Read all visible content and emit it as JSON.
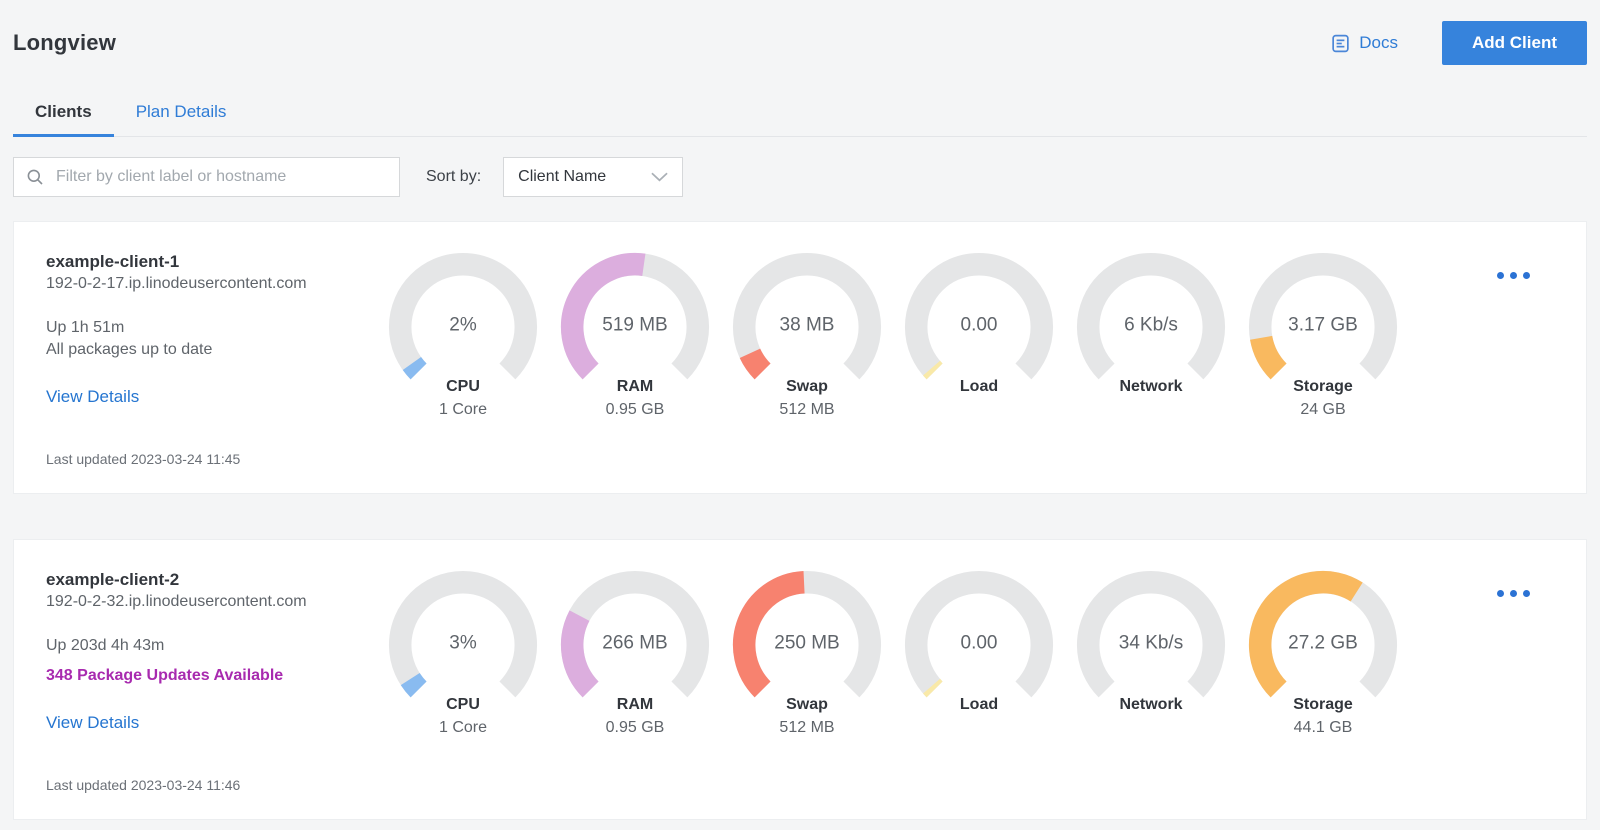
{
  "page": {
    "title": "Longview"
  },
  "header": {
    "docs_label": "Docs",
    "add_client_label": "Add Client"
  },
  "tabs": [
    {
      "label": "Clients",
      "active": true
    },
    {
      "label": "Plan Details",
      "active": false
    }
  ],
  "filter": {
    "placeholder": "Filter by client label or hostname",
    "sort_by_label": "Sort by:",
    "sort_value": "Client Name"
  },
  "colors": {
    "accent_blue": "#3683dc",
    "link_blue": "#2575d0",
    "package_alert_purple": "#a82aaf",
    "gauge_track": "#e5e6e7"
  },
  "clients": [
    {
      "name": "example-client-1",
      "hostname": "192-0-2-17.ip.linodeusercontent.com",
      "uptime": "Up 1h 51m",
      "packages": "All packages up to date",
      "packages_highlight": false,
      "view_details_label": "View Details",
      "last_updated": "Last updated 2023-03-24 11:45",
      "gauges": [
        {
          "metric": "CPU",
          "value": "2%",
          "subtitle": "1 Core",
          "fraction": 0.035,
          "color": "#89bbf0"
        },
        {
          "metric": "RAM",
          "value": "519 MB",
          "subtitle": "0.95 GB",
          "fraction": 0.53,
          "color": "#dcaede"
        },
        {
          "metric": "Swap",
          "value": "38 MB",
          "subtitle": "512 MB",
          "fraction": 0.075,
          "color": "#f7826f"
        },
        {
          "metric": "Load",
          "value": "0.00",
          "subtitle": "",
          "fraction": 0.015,
          "color": "#f9e9a8"
        },
        {
          "metric": "Network",
          "value": "6 Kb/s",
          "subtitle": "",
          "fraction": 0,
          "color": "#89bbf0"
        },
        {
          "metric": "Storage",
          "value": "3.17 GB",
          "subtitle": "24 GB",
          "fraction": 0.13,
          "color": "#f9b95f"
        }
      ]
    },
    {
      "name": "example-client-2",
      "hostname": "192-0-2-32.ip.linodeusercontent.com",
      "uptime": "Up 203d 4h 43m",
      "packages": "348 Package Updates Available",
      "packages_highlight": true,
      "view_details_label": "View Details",
      "last_updated": "Last updated 2023-03-24 11:46",
      "gauges": [
        {
          "metric": "CPU",
          "value": "3%",
          "subtitle": "1 Core",
          "fraction": 0.045,
          "color": "#89bbf0"
        },
        {
          "metric": "RAM",
          "value": "266 MB",
          "subtitle": "0.95 GB",
          "fraction": 0.27,
          "color": "#dcaede"
        },
        {
          "metric": "Swap",
          "value": "250 MB",
          "subtitle": "512 MB",
          "fraction": 0.49,
          "color": "#f7826f"
        },
        {
          "metric": "Load",
          "value": "0.00",
          "subtitle": "",
          "fraction": 0.015,
          "color": "#f9e9a8"
        },
        {
          "metric": "Network",
          "value": "34 Kb/s",
          "subtitle": "",
          "fraction": 0,
          "color": "#89bbf0"
        },
        {
          "metric": "Storage",
          "value": "27.2 GB",
          "subtitle": "44.1 GB",
          "fraction": 0.62,
          "color": "#f9b95f"
        }
      ]
    }
  ]
}
